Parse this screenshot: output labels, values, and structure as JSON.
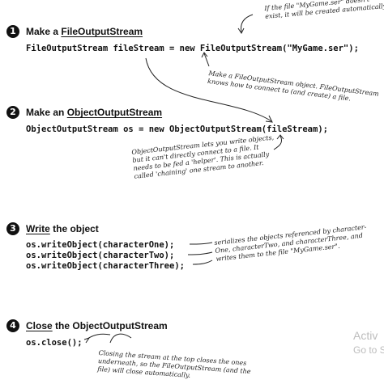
{
  "steps": [
    {
      "num": "1",
      "prefix": "Make a ",
      "keyword": "FileOutputStream",
      "suffix": ""
    },
    {
      "num": "2",
      "prefix": "Make an ",
      "keyword": "ObjectOutputStream",
      "suffix": ""
    },
    {
      "num": "3",
      "prefix": "",
      "keyword": "Write",
      "suffix": " the object"
    },
    {
      "num": "4",
      "prefix": "",
      "keyword": "Close",
      "suffix": " the ObjectOutputStream"
    }
  ],
  "code": {
    "step1": "FileOutputStream fileStream = new FileOutputStream(\"MyGame.ser\");",
    "step2": "ObjectOutputStream os = new ObjectOutputStream(fileStream);",
    "step3": [
      "os.writeObject(characterOne);",
      "os.writeObject(characterTwo);",
      "os.writeObject(characterThree);"
    ],
    "step4": "os.close();"
  },
  "notes": {
    "file_created": "If the file \"MyGame.ser\" doesn't\nexist, it will be created automatically.",
    "file_stream": "Make a FileOutputStream object. FileOutputStream\nknows how to connect to (and create) a file.",
    "object_stream": "ObjectOutputStream lets you write objects,\nbut it can't directly connect to a file. It\nneeds to be fed a 'helper'. This is actually\ncalled 'chaining' one stream to another.",
    "serializes": "serializes the objects referenced by character-\nOne, characterTwo, and characterThree, and\nwrites them to the file \"MyGame.ser\".",
    "closing": "Closing the stream at the top closes the ones\nunderneath, so the FileOutputStream (and the\nfile) will close automatically."
  },
  "watermark": {
    "line1": "Activ",
    "line2": "Go to S"
  }
}
